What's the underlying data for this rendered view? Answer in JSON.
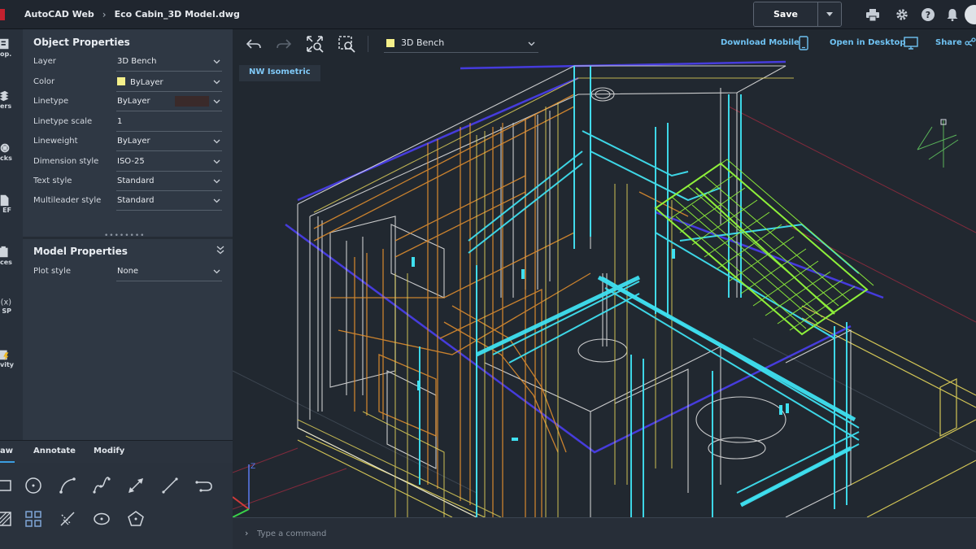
{
  "topbar": {
    "app_title": "AutoCAD Web",
    "breadcrumb_sep": "›",
    "file_name": "Eco Cabin_3D Model.dwg",
    "save_label": "Save",
    "icons": [
      "print-icon",
      "gear-icon",
      "help-icon",
      "bell-icon",
      "avatar"
    ]
  },
  "rail": {
    "items": [
      {
        "label": "op.",
        "icon": "properties-icon"
      },
      {
        "label": "ers",
        "icon": "layers-icon"
      },
      {
        "label": "cks",
        "icon": "blocks-icon"
      },
      {
        "label": "EF",
        "icon": "xref-icon"
      },
      {
        "label": "ces",
        "icon": "traces-icon"
      },
      {
        "label": "SP",
        "icon": "lisp-icon"
      },
      {
        "label": "vity",
        "icon": "activity-icon"
      }
    ]
  },
  "object_properties": {
    "title": "Object Properties",
    "rows": [
      {
        "label": "Layer",
        "value": "3D Bench"
      },
      {
        "label": "Color",
        "value": "ByLayer"
      },
      {
        "label": "Linetype",
        "value": "ByLayer"
      },
      {
        "label": "Linetype scale",
        "value": "1"
      },
      {
        "label": "Lineweight",
        "value": "ByLayer"
      },
      {
        "label": "Dimension style",
        "value": "ISO-25"
      },
      {
        "label": "Text style",
        "value": "Standard"
      },
      {
        "label": "Multileader style",
        "value": "Standard"
      }
    ]
  },
  "model_properties": {
    "title": "Model Properties",
    "rows": [
      {
        "label": "Plot style",
        "value": "None"
      }
    ]
  },
  "tool_tabs": {
    "draw": "aw",
    "annotate": "Annotate",
    "modify": "Modify"
  },
  "viewport": {
    "current_layer": "3D Bench",
    "layer_color": "#f5f08a",
    "download_mobile": "Download Mobile",
    "open_desktop": "Open in Desktop",
    "share": "Share",
    "view_label": "NW Isometric"
  },
  "command": {
    "placeholder": "Type a command"
  },
  "colors": {
    "accent": "#6fc2f2",
    "wire_cyan": "#3fe0f0",
    "wire_orange": "#e8922e",
    "wire_yellow": "#e6d65a",
    "wire_green": "#8ef03a",
    "wire_blue": "#4a3ef0",
    "wire_white": "#e8e8e8"
  }
}
